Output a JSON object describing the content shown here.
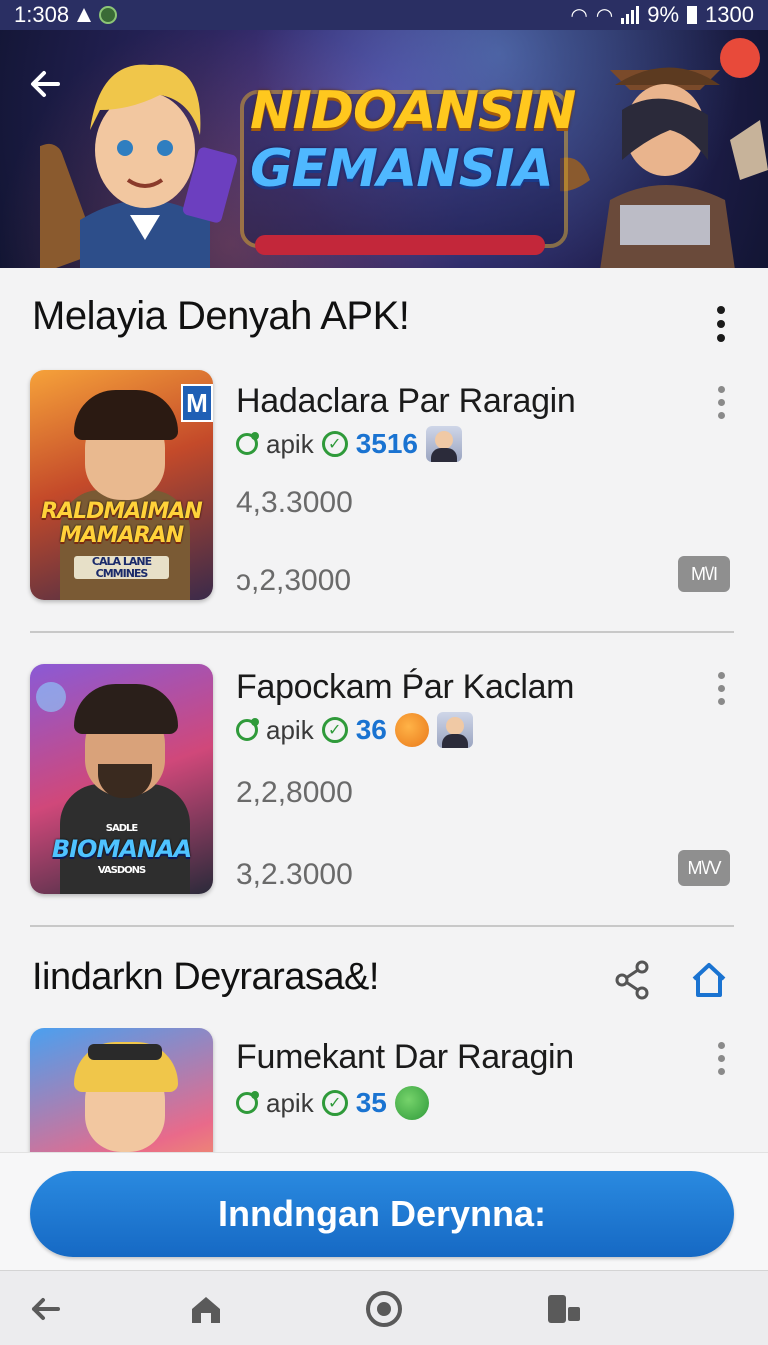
{
  "status_bar": {
    "time": "1:308",
    "battery_percent": "9%",
    "clock_right": "1300"
  },
  "banner": {
    "logo_line1": "NIDOANSIN",
    "logo_line2": "GEMANSIA"
  },
  "section1": {
    "title": "Melayia Denyah APK!"
  },
  "apps": [
    {
      "title": "Hadaclara Par Raragin",
      "apk_label": "apik",
      "count": "3516",
      "value1": "4,3.3000",
      "value2": "ɔ,2,3000",
      "badge": "M\\/I",
      "thumb_caption1": "RALDMAIMAN",
      "thumb_caption2": "MAMARAN",
      "thumb_caption3": "CALA LANE CMMINES",
      "thumb_corner": "M"
    },
    {
      "title": "Fapockam Ṕar Kaclam",
      "apk_label": "apik",
      "count": "36",
      "value1": "2,2,8000",
      "value2": "3,2.3000",
      "badge": "M\\/V",
      "thumb_caption0": "SADLE",
      "thumb_caption1": "BIOMANAA",
      "thumb_caption2": "VASDONS"
    },
    {
      "title": "Fumekant Dar Raragin",
      "apk_label": "apik",
      "count": "35"
    }
  ],
  "section2": {
    "title": "Iindarkn Deyrarasa&!"
  },
  "cta": {
    "label": "Inndngan Derynna:"
  },
  "colors": {
    "accent": "#1a73d1",
    "status_bar": "#2a2f63",
    "green": "#2f9a3a"
  }
}
